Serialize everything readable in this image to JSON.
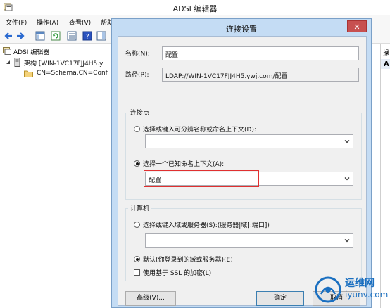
{
  "main_window": {
    "title": "ADSI 编辑器",
    "menu": [
      "文件(F)",
      "操作(A)",
      "查看(V)",
      "帮助"
    ],
    "tree": {
      "root": "ADSI 编辑器",
      "node": "架构 [WIN-1VC17FJJ4H5.y",
      "child": "CN=Schema,CN=Conf"
    },
    "right_header": "操",
    "right_item": "A"
  },
  "dialog": {
    "title": "连接设置",
    "close_glyph": "✕",
    "name_label": "名称(N):",
    "name_value": "配置",
    "path_label": "路径(P):",
    "path_value": "LDAP://WIN-1VC17FJJ4H5.ywj.com/配置",
    "connection_point": {
      "title": "连接点",
      "option_dn": "选择或键入可分辨名称或命名上下文(D):",
      "dn_value": "",
      "option_known": "选择一个已知命名上下文(A):",
      "known_value": "配置"
    },
    "computer": {
      "title": "计算机",
      "option_server": "选择或键入域或服务器(S):(服务器|域[:端口])",
      "server_value": "",
      "option_default": "默认(你登录到的域或服务器)(E)",
      "ssl_label": "使用基于 SSL 的加密(L)"
    },
    "buttons": {
      "advanced": "高级(V)...",
      "ok": "确定",
      "cancel": "取消"
    }
  },
  "watermark": {
    "text_cn": "运维网",
    "text_url": "iyunv.com"
  },
  "colors": {
    "dialog_frame": "#c4dcf4",
    "close_button": "#c75050",
    "highlight": "#e03030",
    "watermark_blue": "#1a6fc0"
  }
}
